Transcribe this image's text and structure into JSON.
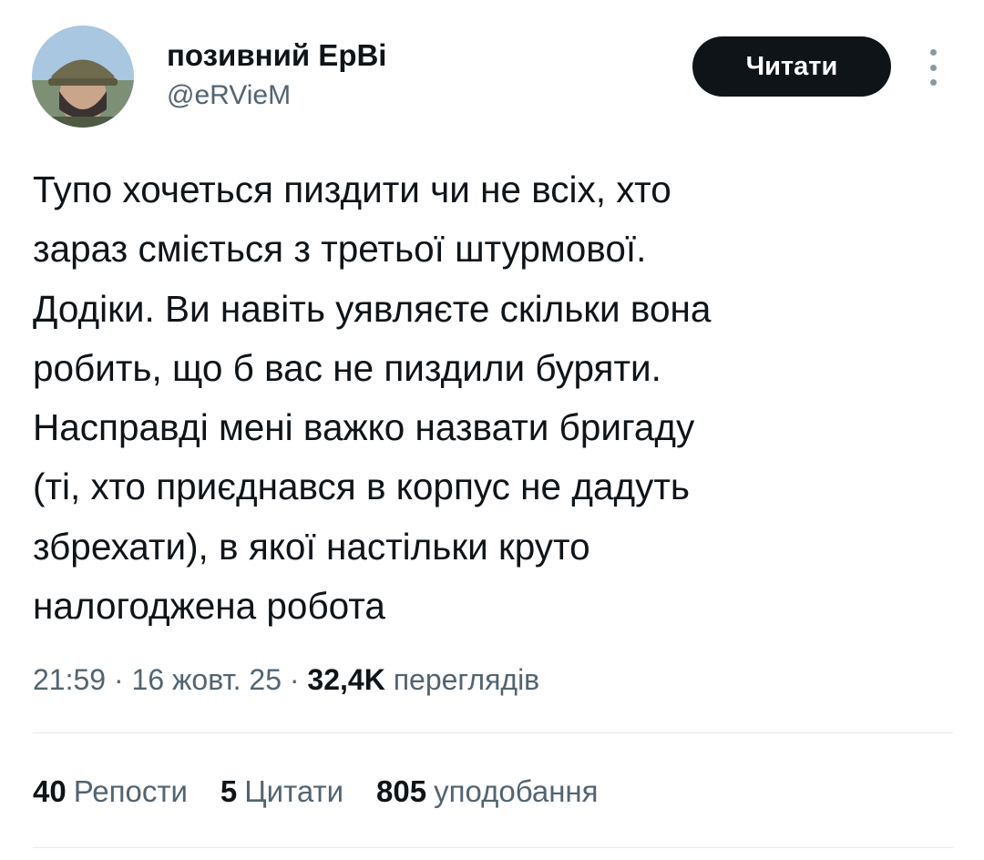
{
  "author": {
    "name": "позивний ЕрВі",
    "handle": "@eRVieM"
  },
  "follow_button_label": "Читати",
  "more_icon": "more-vertical-icon",
  "tweet_text": "Тупо хочеться пиздити чи не всіх, хто\nзараз сміється з третьої штурмової.\nДодіки. Ви навіть уявляєте скільки вона\nробить, що б вас не пиздили буряти.\nНасправді мені важко назвати бригаду\n(ті, хто приєднався в корпус не дадуть\nзбрехати), в якої настільки круто\nналогоджена робота",
  "meta": {
    "time": "21:59",
    "date": "16 жовт. 25",
    "views_count": "32,4K",
    "views_label": "переглядів",
    "separator": "·"
  },
  "stats": {
    "reposts_count": "40",
    "reposts_label": "Репости",
    "quotes_count": "5",
    "quotes_label": "Цитати",
    "likes_count": "805",
    "likes_label": "уподобання"
  },
  "colors": {
    "text": "#0f1419",
    "secondary": "#536471",
    "button_bg": "#0f1419",
    "divider": "#e6e9ea"
  }
}
